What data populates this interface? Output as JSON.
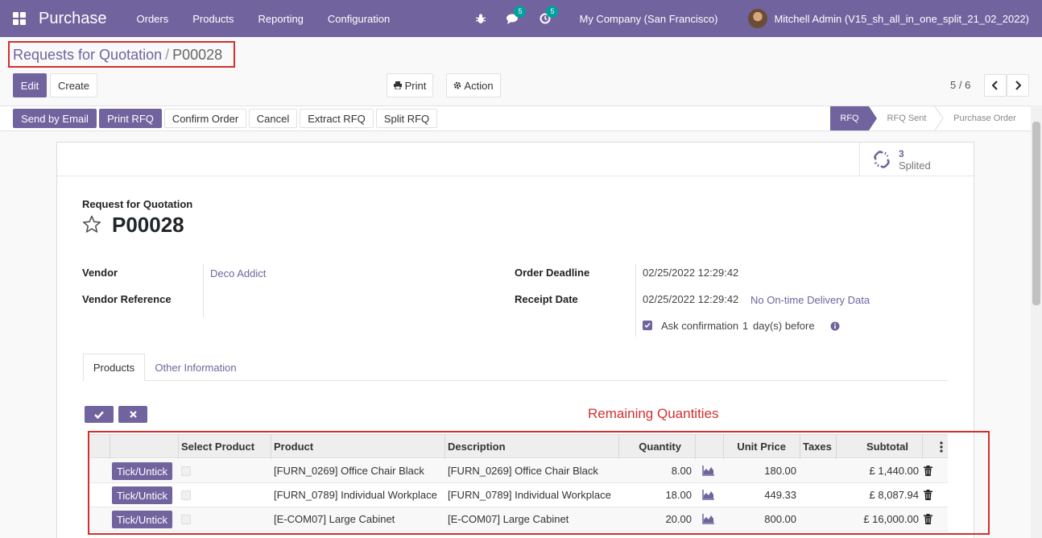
{
  "navbar": {
    "app_name": "Purchase",
    "menu": [
      "Orders",
      "Products",
      "Reporting",
      "Configuration"
    ],
    "chat_count": "5",
    "activity_count": "5",
    "company": "My Company (San Francisco)",
    "user": "Mitchell Admin (V15_sh_all_in_one_split_21_02_2022)"
  },
  "breadcrumb": {
    "parent": "Requests for Quotation",
    "separator": "/",
    "current": "P00028"
  },
  "controls": {
    "edit": "Edit",
    "create": "Create",
    "print": "Print",
    "action": "Action",
    "pager": "5 / 6"
  },
  "status_buttons": [
    "Send by Email",
    "Print RFQ",
    "Confirm Order",
    "Cancel",
    "Extract RFQ",
    "Split RFQ"
  ],
  "stages": [
    "RFQ",
    "RFQ Sent",
    "Purchase Order"
  ],
  "smart_button": {
    "count": "3",
    "label": "Splited"
  },
  "document": {
    "type_label": "Request for Quotation",
    "name": "P00028"
  },
  "fields": {
    "vendor_label": "Vendor",
    "vendor_value": "Deco Addict",
    "vendor_ref_label": "Vendor Reference",
    "order_deadline_label": "Order Deadline",
    "order_deadline_value": "02/25/2022 12:29:42",
    "receipt_date_label": "Receipt Date",
    "receipt_date_value": "02/25/2022 12:29:42",
    "on_time_link": "No On-time Delivery Data",
    "ask_confirmation": "Ask confirmation",
    "ask_days": "1",
    "ask_suffix": "day(s) before"
  },
  "tabs": [
    "Products",
    "Other Information"
  ],
  "annotation": "Remaining Quantities",
  "table": {
    "headers": {
      "select": "Select Product",
      "product": "Product",
      "description": "Description",
      "quantity": "Quantity",
      "unit_price": "Unit Price",
      "taxes": "Taxes",
      "subtotal": "Subtotal"
    },
    "tick_label": "Tick/Untick",
    "rows": [
      {
        "product": "[FURN_0269] Office Chair Black",
        "description": "[FURN_0269] Office Chair Black",
        "quantity": "8.00",
        "unit_price": "180.00",
        "subtotal": "£ 1,440.00"
      },
      {
        "product": "[FURN_0789] Individual Workplace",
        "description": "[FURN_0789] Individual Workplace",
        "quantity": "18.00",
        "unit_price": "449.33",
        "subtotal": "£ 8,087.94"
      },
      {
        "product": "[E-COM07] Large Cabinet",
        "description": "[E-COM07] Large Cabinet",
        "quantity": "20.00",
        "unit_price": "800.00",
        "subtotal": "£ 16,000.00"
      }
    ]
  },
  "colors": {
    "brand": "#71639e",
    "highlight": "#d32f2f",
    "badge": "#00a09d"
  }
}
